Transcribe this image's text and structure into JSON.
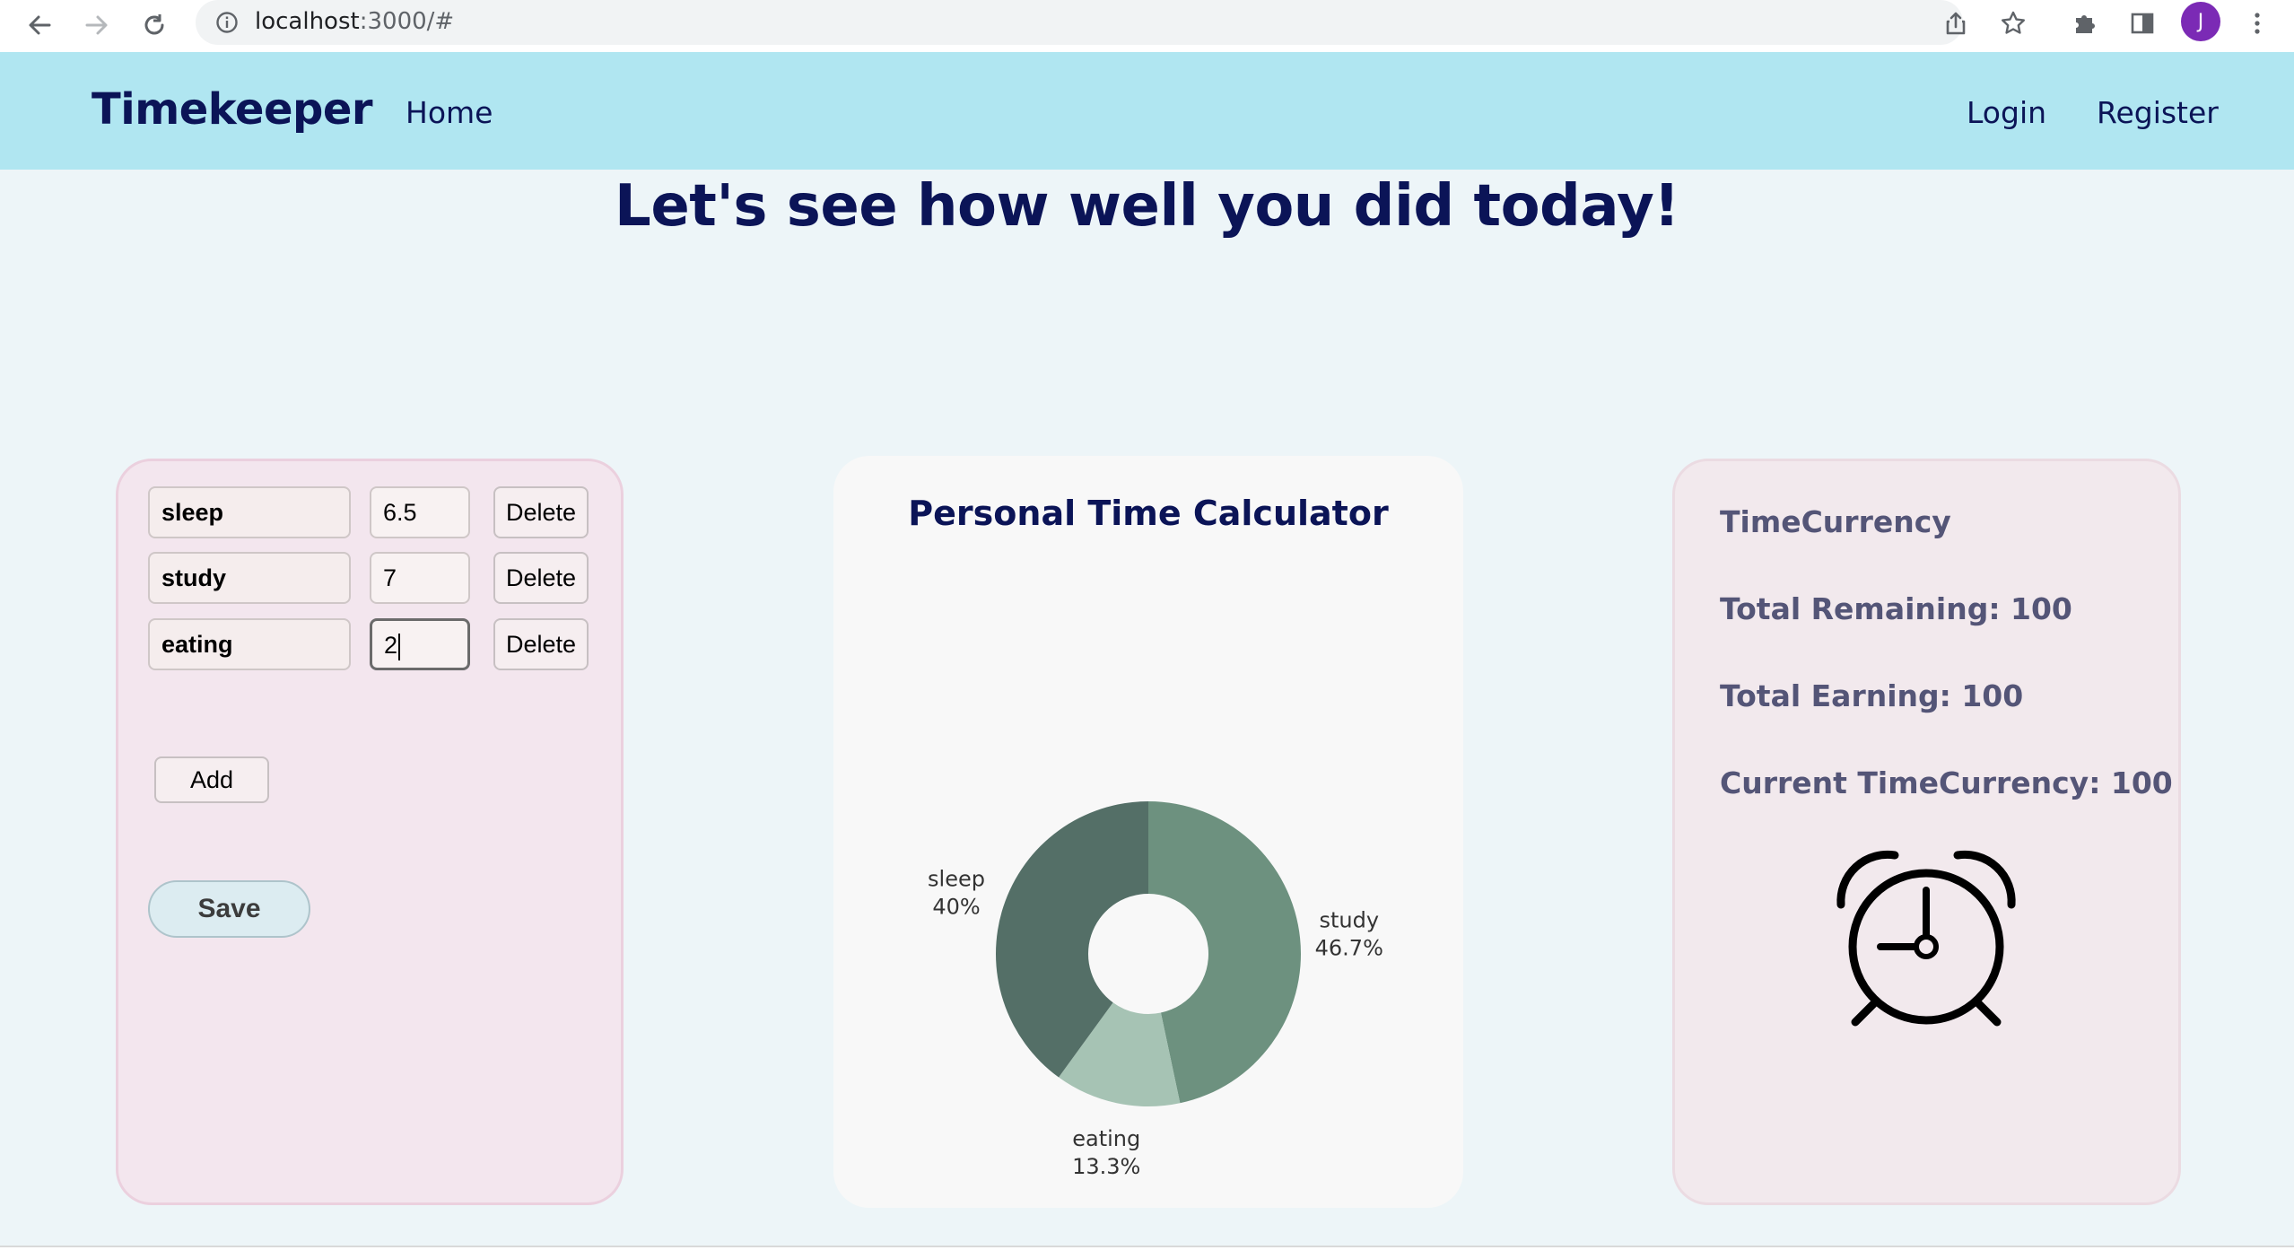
{
  "browser": {
    "url_host": "localhost",
    "url_path": ":3000/#",
    "avatar_letter": "J",
    "icons": [
      "back-arrow-icon",
      "forward-arrow-icon",
      "reload-icon",
      "info-icon",
      "share-icon",
      "star-icon",
      "puzzle-icon",
      "sidebar-icon",
      "kebab-menu-icon"
    ]
  },
  "navbar": {
    "brand": "Timekeeper",
    "home": "Home",
    "login": "Login",
    "register": "Register"
  },
  "headline": "Let's see how well you did today!",
  "activities": {
    "rows": [
      {
        "name": "sleep",
        "hours": "6.5"
      },
      {
        "name": "study",
        "hours": "7"
      },
      {
        "name": "eating",
        "hours": "2"
      }
    ],
    "delete_label": "Delete",
    "add_label": "Add",
    "save_label": "Save"
  },
  "calculator": {
    "title": "Personal Time Calculator"
  },
  "chart_data": {
    "type": "pie",
    "donut": true,
    "slices": [
      {
        "label": "study",
        "percent": "46.7%",
        "value": 7,
        "color": "#6d917f"
      },
      {
        "label": "eating",
        "percent": "13.3%",
        "value": 2,
        "color": "#a6c3b4"
      },
      {
        "label": "sleep",
        "percent": "40%",
        "value": 6,
        "color": "#546f67"
      }
    ]
  },
  "timecurrency": {
    "title": "TimeCurrency",
    "remaining": "Total Remaining: 100",
    "earning": "Total Earning: 100",
    "current": "Current TimeCurrency: 100",
    "icon": "alarm-clock-icon"
  },
  "colors": {
    "navbar_bg": "#b0e6f1",
    "brand_text": "#0b1457",
    "page_bg": "#edf5f8"
  }
}
